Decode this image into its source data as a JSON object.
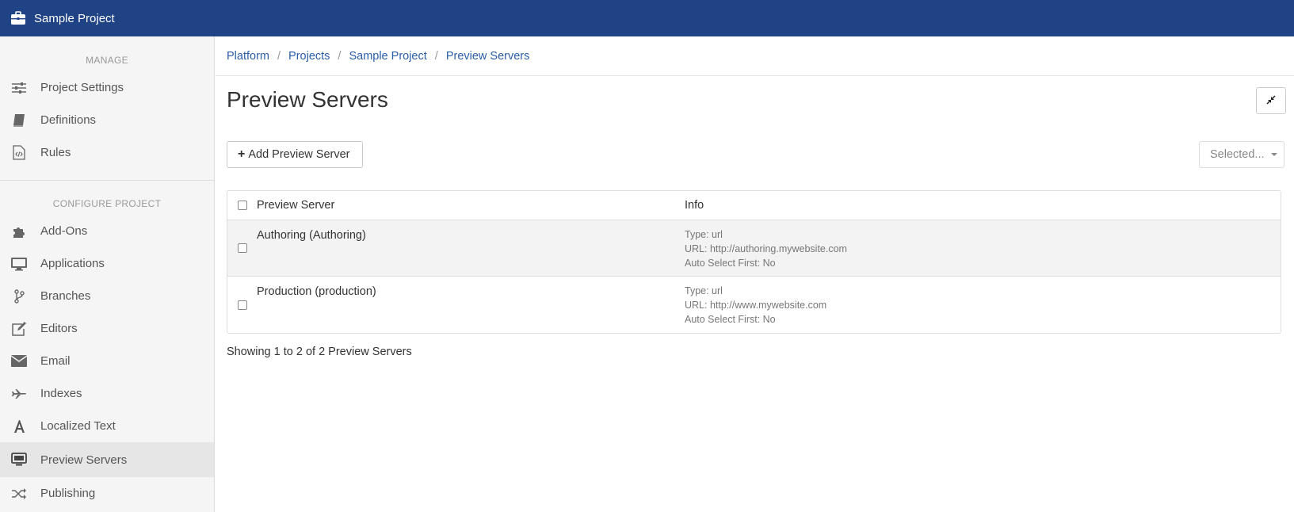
{
  "header": {
    "title": "Sample Project",
    "icon": "briefcase-icon",
    "background": "#1f4385"
  },
  "sidebar": {
    "manage_label": "MANAGE",
    "manage_items": [
      {
        "label": "Project Settings",
        "icon": "sliders-icon"
      },
      {
        "label": "Definitions",
        "icon": "book-icon"
      },
      {
        "label": "Rules",
        "icon": "code-file-icon"
      }
    ],
    "configure_label": "CONFIGURE PROJECT",
    "configure_items": [
      {
        "label": "Add-Ons",
        "icon": "puzzle-icon"
      },
      {
        "label": "Applications",
        "icon": "monitor-icon"
      },
      {
        "label": "Branches",
        "icon": "branch-icon"
      },
      {
        "label": "Editors",
        "icon": "edit-icon"
      },
      {
        "label": "Email",
        "icon": "envelope-icon"
      },
      {
        "label": "Indexes",
        "icon": "plane-icon"
      },
      {
        "label": "Localized Text",
        "icon": "font-icon"
      },
      {
        "label": "Preview Servers",
        "icon": "desktop-icon",
        "active": true
      },
      {
        "label": "Publishing",
        "icon": "shuffle-icon"
      }
    ]
  },
  "breadcrumb": [
    "Platform",
    "Projects",
    "Sample Project",
    "Preview Servers"
  ],
  "page": {
    "title": "Preview Servers",
    "add_button": "Add Preview Server",
    "selected_button": "Selected..."
  },
  "table": {
    "headers": [
      "Preview Server",
      "Info"
    ],
    "rows": [
      {
        "name": "Authoring (Authoring)",
        "info": [
          "Type: url",
          "URL: http://authoring.mywebsite.com",
          "Auto Select First: No"
        ]
      },
      {
        "name": "Production (production)",
        "info": [
          "Type: url",
          "URL: http://www.mywebsite.com",
          "Auto Select First: No"
        ]
      }
    ]
  },
  "footer": {
    "showing": "Showing 1 to 2 of 2 Preview Servers"
  }
}
